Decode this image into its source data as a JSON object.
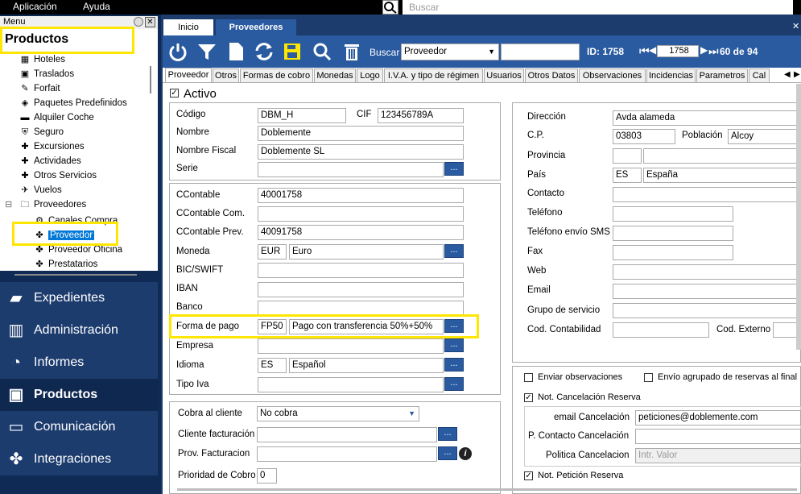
{
  "menubar": {
    "app": "Aplicación",
    "help": "Ayuda",
    "search_placeholder": "Buscar"
  },
  "left": {
    "menu_label": "Menu",
    "panel_title": "Productos",
    "tree": [
      {
        "label": "Hoteles",
        "icon": "hotel-icon"
      },
      {
        "label": "Traslados",
        "icon": "bus-icon"
      },
      {
        "label": "Forfait",
        "icon": "ticket-icon"
      },
      {
        "label": "Paquetes Predefinidos",
        "icon": "package-icon"
      },
      {
        "label": "Alquiler Coche",
        "icon": "car-icon"
      },
      {
        "label": "Seguro",
        "icon": "shield-icon"
      },
      {
        "label": "Excursiones",
        "icon": "pin-icon"
      },
      {
        "label": "Actividades",
        "icon": "activity-icon"
      },
      {
        "label": "Otros Servicios",
        "icon": "pin-icon"
      },
      {
        "label": "Vuelos",
        "icon": "plane-icon"
      },
      {
        "label": "Proveedores",
        "icon": "folder-icon"
      },
      {
        "label": "Canales Compra",
        "icon": "channel-icon"
      },
      {
        "label": "Proveedor",
        "icon": "puzzle-icon",
        "selected": true
      },
      {
        "label": "Proveedor Oficina",
        "icon": "puzzle-icon"
      },
      {
        "label": "Prestatarios",
        "icon": "puzzle-icon"
      }
    ],
    "nav": [
      {
        "label": "Expedientes",
        "icon": "folder-icon"
      },
      {
        "label": "Administración",
        "icon": "chart-icon"
      },
      {
        "label": "Informes",
        "icon": "pie-icon"
      },
      {
        "label": "Productos",
        "icon": "briefcase-icon",
        "active": true
      },
      {
        "label": "Comunicación",
        "icon": "monitor-icon"
      },
      {
        "label": "Integraciones",
        "icon": "puzzle-icon"
      }
    ]
  },
  "tabs": {
    "inicio": "Inicio",
    "proveedores": "Proveedores",
    "close": "✕"
  },
  "toolbar": {
    "search_label": "Buscar",
    "search_field": "Proveedor",
    "search_value": "",
    "id_label": "ID: 1758",
    "record": "1758",
    "of_label": "60 de 94"
  },
  "subtabs": [
    "Proveedor",
    "Otros",
    "Formas de cobro",
    "Monedas",
    "Logo",
    "I.V.A. y tipo de régimen",
    "Usuarios",
    "Otros Datos",
    "Observaciones",
    "Incidencias",
    "Parametros",
    "Cal"
  ],
  "form": {
    "activo": "Activo",
    "codigo_label": "Código",
    "codigo": "DBM_H",
    "cif_label": "CIF",
    "cif": "123456789A",
    "nombre_label": "Nombre",
    "nombre": "Doblemente",
    "nombre_fiscal_label": "Nombre Fiscal",
    "nombre_fiscal": "Doblemente SL",
    "serie_label": "Serie",
    "serie": "",
    "ccontable_label": "CContable",
    "ccontable": "40001758",
    "ccontable_com_label": "CContable Com.",
    "ccontable_com": "",
    "ccontable_prev_label": "CContable Prev.",
    "ccontable_prev": "40091758",
    "moneda_label": "Moneda",
    "moneda_code": "EUR",
    "moneda": "Euro",
    "bic_label": "BIC/SWIFT",
    "bic": "",
    "iban_label": "IBAN",
    "iban": "",
    "banco_label": "Banco",
    "banco": "",
    "forma_pago_label": "Forma de pago",
    "forma_pago_code": "FP50",
    "forma_pago": "Pago con transferencia 50%+50%",
    "empresa_label": "Empresa",
    "empresa": "",
    "idioma_label": "Idioma",
    "idioma_code": "ES",
    "idioma": "Español",
    "tipo_iva_label": "Tipo Iva",
    "tipo_iva": "",
    "cobra_label": "Cobra al cliente",
    "cobra": "No cobra",
    "cliente_fact_label": "Cliente facturación",
    "cliente_fact": "",
    "prov_fact_label": "Prov. Facturacion",
    "prov_fact": "",
    "prioridad_label": "Prioridad de Cobro",
    "prioridad": "0",
    "direccion_label": "Dirección",
    "direccion": "Avda alameda",
    "cp_label": "C.P.",
    "cp": "03803",
    "poblacion_label": "Población",
    "poblacion": "Alcoy",
    "provincia_label": "Provincia",
    "provincia_code": "",
    "provincia": "",
    "pais_label": "País",
    "pais_code": "ES",
    "pais": "España",
    "contacto_label": "Contacto",
    "contacto": "",
    "telefono_label": "Teléfono",
    "telefono": "",
    "telefono_sms_label": "Teléfono envío SMS",
    "telefono_sms": "",
    "fax_label": "Fax",
    "fax": "",
    "web_label": "Web",
    "web": "",
    "email_label": "Email",
    "email": "",
    "grupo_label": "Grupo de servicio",
    "grupo": "",
    "cod_cont_label": "Cod. Contabilidad",
    "cod_cont": "",
    "cod_ext_label": "Cod. Externo",
    "cod_ext": "",
    "enviar_obs": "Enviar observaciones",
    "envio_agrupado": "Envío agrupado de reservas al final",
    "not_cancel": "Not. Cancelación Reserva",
    "email_cancel_label": "email Cancelación",
    "email_cancel": "peticiones@doblemente.com",
    "p_contacto_label": "P. Contacto Cancelación",
    "p_contacto": "",
    "politica_label": "Politica Cancelacion",
    "politica_placeholder": "Intr. Valor",
    "not_peticion": "Not. Petición Reserva"
  }
}
